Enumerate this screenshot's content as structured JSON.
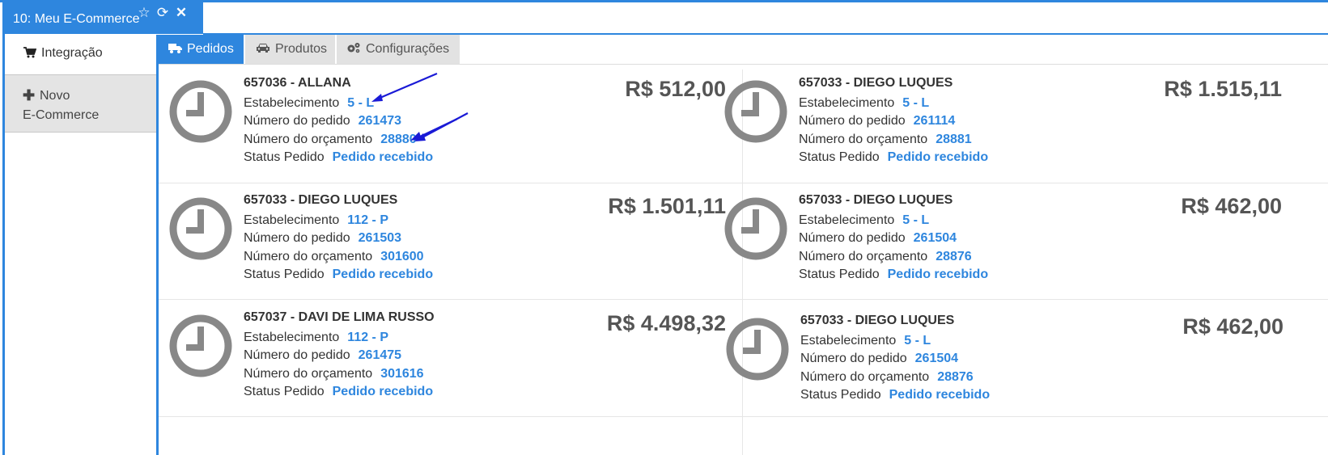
{
  "window": {
    "title": "10: Meu E-Commerce",
    "icons": [
      "star-icon",
      "refresh-icon",
      "close-icon"
    ]
  },
  "sidebar": {
    "items": [
      {
        "icon": "cart-icon",
        "label": "Integração"
      },
      {
        "icon": "plus-icon",
        "label_line1": "Novo",
        "label_line2": "E-Commerce"
      }
    ]
  },
  "tabs": [
    {
      "icon": "truck-icon",
      "label": "Pedidos",
      "active": true
    },
    {
      "icon": "car-icon",
      "label": "Produtos",
      "active": false
    },
    {
      "icon": "gears-icon",
      "label": "Configurações",
      "active": false
    }
  ],
  "field_labels": {
    "estabelecimento": "Estabelecimento",
    "numero_pedido": "Número do pedido",
    "numero_orcamento": "Número do orçamento",
    "status": "Status Pedido"
  },
  "orders": [
    {
      "title": "657036 - ALLANA",
      "estabelecimento": "5 - L",
      "pedido": "261473",
      "orcamento": "28880",
      "status": "Pedido recebido",
      "price": "R$ 512,00"
    },
    {
      "title": "657033 - DIEGO LUQUES",
      "estabelecimento": "5 - L",
      "pedido": "261114",
      "orcamento": "28881",
      "status": "Pedido recebido",
      "price": "R$ 1.515,11"
    },
    {
      "title": "657033 - DIEGO LUQUES",
      "estabelecimento": "112 - P",
      "pedido": "261503",
      "orcamento": "301600",
      "status": "Pedido recebido",
      "price": "R$ 1.501,11"
    },
    {
      "title": "657033 - DIEGO LUQUES",
      "estabelecimento": "5 - L",
      "pedido": "261504",
      "orcamento": "28876",
      "status": "Pedido recebido",
      "price": "R$ 462,00"
    },
    {
      "title": "657037 - DAVI DE LIMA RUSSO",
      "estabelecimento": "112 - P",
      "pedido": "261475",
      "orcamento": "301616",
      "status": "Pedido recebido",
      "price": "R$ 4.498,32"
    },
    {
      "title": "657033 - DIEGO LUQUES",
      "estabelecimento": "5 - L",
      "pedido": "261504",
      "orcamento": "28876",
      "status": "Pedido recebido",
      "price": "R$ 462,00"
    }
  ],
  "colors": {
    "accent": "#2e86de",
    "clock": "#888888",
    "price": "#555555"
  }
}
